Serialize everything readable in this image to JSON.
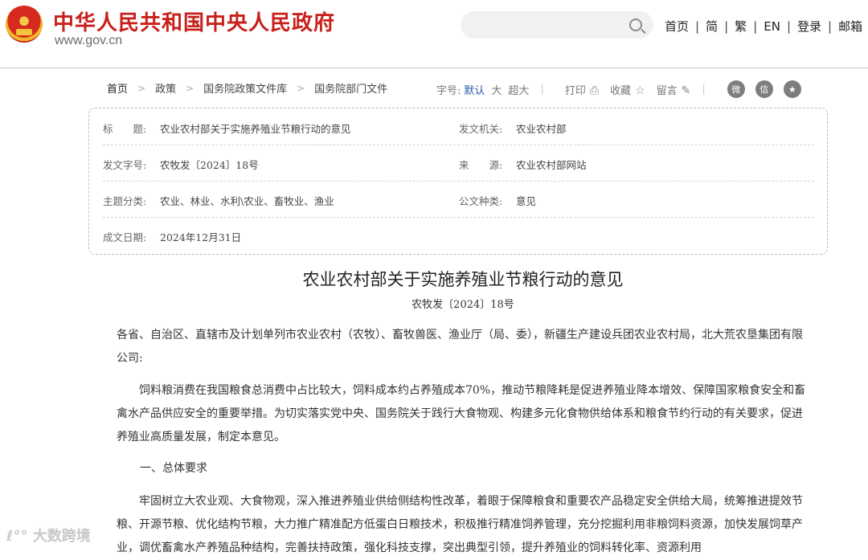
{
  "header": {
    "site_title": "中华人民共和国中央人民政府",
    "site_domain": "www.gov.cn",
    "search": {
      "placeholder": ""
    },
    "nav": [
      "首页",
      "简",
      "繁",
      "EN",
      "登录",
      "邮箱"
    ]
  },
  "breadcrumb": [
    "首页",
    "政策",
    "国务院政策文件库",
    "国务院部门文件"
  ],
  "toolbar": {
    "font_label": "字号:",
    "font_sizes": [
      "默认",
      "大",
      "超大"
    ],
    "print": "打印",
    "favorite": "收藏",
    "comment": "留言",
    "share": [
      "weibo-icon",
      "wechat-icon",
      "star-icon"
    ],
    "active_color": "#2a58a8"
  },
  "meta": {
    "title_label": "标　　题:",
    "title_value": "农业农村部关于实施养殖业节粮行动的意见",
    "issuer_label": "发文机关:",
    "issuer_value": "农业农村部",
    "docno_label": "发文字号:",
    "docno_value": "农牧发〔2024〕18号",
    "source_label": "来　　源:",
    "source_value": "农业农村部网站",
    "topic_label": "主题分类:",
    "topic_value": "农业、林业、水利\\农业、畜牧业、渔业",
    "type_label": "公文种类:",
    "type_value": "意见",
    "date_label": "成文日期:",
    "date_value": "2024年12月31日"
  },
  "article": {
    "title": "农业农村部关于实施养殖业节粮行动的意见",
    "doc_no": "农牧发〔2024〕18号",
    "addressee": "各省、自治区、直辖市及计划单列市农业农村（农牧）、畜牧兽医、渔业厅（局、委），新疆生产建设兵团农业农村局，北大荒农垦集团有限公司:",
    "paragraph1": "饲料粮消费在我国粮食总消费中占比较大，饲料成本约占养殖成本70%，推动节粮降耗是促进养殖业降本增效、保障国家粮食安全和畜禽水产品供应安全的重要举措。为切实落实党中央、国务院关于践行大食物观、构建多元化食物供给体系和粮食节约行动的有关要求，促进养殖业高质量发展，制定本意见。",
    "section1": "一、总体要求",
    "paragraph2": "牢固树立大农业观、大食物观，深入推进养殖业供给侧结构性改革，着眼于保障粮食和重要农产品稳定安全供给大局，统筹推进提效节粮、开源节粮、优化结构节粮，大力推广精准配方低蛋白日粮技术，积极推行精准饲养管理，充分挖掘利用非粮饲料资源，加快发展饲草产业，调优畜禽水产养殖品种结构，完善扶持政策，强化科技支撑，突出典型引领，提升养殖业的饲料转化率、资源利用"
  },
  "watermark": "大数跨境"
}
